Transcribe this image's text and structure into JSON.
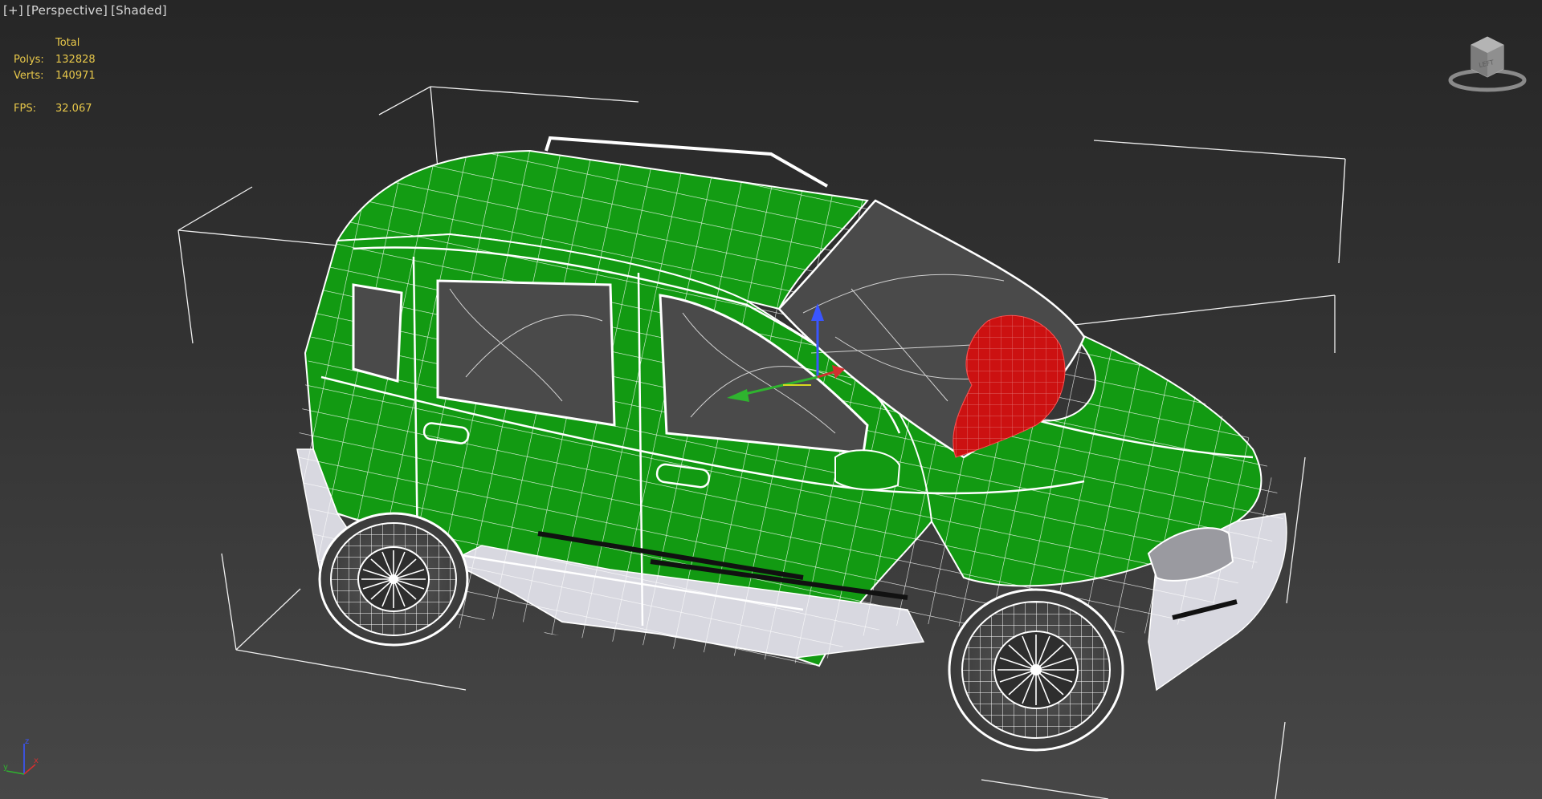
{
  "viewport": {
    "labels": [
      "[+]",
      "[Perspective]",
      "[Shaded]"
    ]
  },
  "stats": {
    "header": "Total",
    "polys_label": "Polys:",
    "polys_value": "132828",
    "verts_label": "Verts:",
    "verts_value": "140971",
    "fps_label": "FPS:",
    "fps_value": "32.067"
  },
  "viewcube": {
    "face_label": "LEFT"
  },
  "axis_tripod": {
    "x": "x",
    "y": "y",
    "z": "z"
  },
  "colors": {
    "body": "#119911",
    "body_dark": "#0b7a0b",
    "wire": "#ffffff",
    "seat": "#cc1111",
    "stats_text": "#e8c84a",
    "axis_x": "#d23030",
    "axis_y": "#2fb32f",
    "axis_z": "#3a55ff"
  }
}
